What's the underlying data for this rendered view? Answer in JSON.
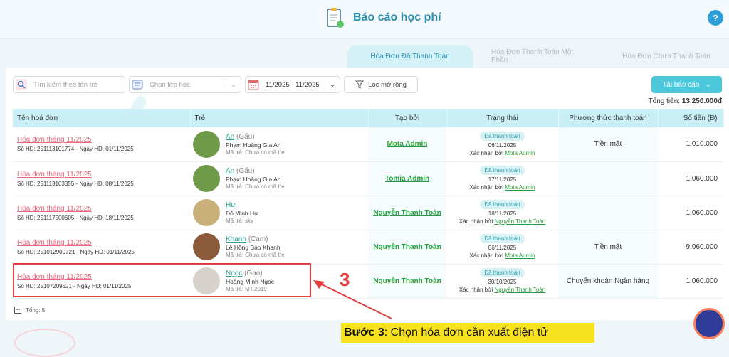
{
  "header": {
    "title": "Báo cáo học phí",
    "help_icon": "?"
  },
  "tabs": [
    {
      "label": "Hóa Đơn Đã Thanh Toán",
      "active": true
    },
    {
      "label": "Hóa Đơn Thanh Toán Một Phần",
      "active": false
    },
    {
      "label": "Hóa Đơn Chưa Thanh Toán",
      "active": false
    }
  ],
  "filters": {
    "search_placeholder": "Tìm kiếm theo tên trẻ",
    "class_placeholder": "Chọn lớp học",
    "date_range": "11/2025 - 11/2025",
    "more_label": "Lọc mở rộng"
  },
  "export_label": "Tải báo cáo",
  "total_label": "Tổng tiền:",
  "total_value": "13.250.000đ",
  "table": {
    "columns": [
      "Tên hoá đơn",
      "Trẻ",
      "Tạo bởi",
      "Trạng thái",
      "Phương thức thanh toán",
      "Số tiền (Đ)"
    ],
    "rows": [
      {
        "invoice": "Hóa đơn tháng 11/2025",
        "sub": "Số HD: 251113101774 - Ngày HD: 01/11/2025",
        "nick": "An",
        "alias": "(Gấu)",
        "full": "Phạm Hoàng Gia An",
        "code": "Mã trẻ: Chưa có mã trẻ",
        "by": "Mota Admin",
        "badge": "Đã thanh toán",
        "date": "06/11/2025",
        "confirm_prefix": "Xác nhận bởi",
        "confirm_by": "Mota Admin",
        "pay": "Tiền mặt",
        "amount": "1.010.000",
        "avatar_color": "#6e9a4a"
      },
      {
        "invoice": "Hóa đơn tháng 11/2025",
        "sub": "Số HD: 251113103355 - Ngày HD: 08/11/2025",
        "nick": "An",
        "alias": "(Gấu)",
        "full": "Phạm Hoàng Gia An",
        "code": "Mã trẻ: Chưa có mã trẻ",
        "by": "Tomia Admin",
        "badge": "Đã thanh toán",
        "date": "17/11/2025",
        "confirm_prefix": "Xác nhận bởi",
        "confirm_by": "Mota Admin",
        "pay": "",
        "amount": "1.060.000",
        "avatar_color": "#6e9a4a"
      },
      {
        "invoice": "Hóa đơn tháng 11/2025",
        "sub": "Số HD: 251117500605 - Ngày HD: 18/11/2025",
        "nick": "Hự",
        "alias": "",
        "full": "Đỗ Minh Hự",
        "code": "Mã trẻ: sky",
        "by": "Nguyễn Thanh Toàn",
        "badge": "Đã thanh toán",
        "date": "18/11/2025",
        "confirm_prefix": "Xác nhận bởi",
        "confirm_by": "Nguyễn Thanh Toàn",
        "pay": "",
        "amount": "1.060.000",
        "avatar_color": "#c9b07a"
      },
      {
        "invoice": "Hóa đơn tháng 11/2025",
        "sub": "Số HD: 251012900721 - Ngày HD: 01/11/2025",
        "nick": "Khanh",
        "alias": "(Cam)",
        "full": "Lê Hồng Bảo Khanh",
        "code": "Mã trẻ: Chưa có mã trẻ",
        "by": "Nguyễn Thanh Toàn",
        "badge": "Đã thanh toán",
        "date": "06/11/2025",
        "confirm_prefix": "Xác nhận bởi",
        "confirm_by": "Mota Admin",
        "pay": "Tiền mặt",
        "amount": "9.060.000",
        "avatar_color": "#8a5a3a"
      },
      {
        "invoice": "Hóa đơn tháng 11/2025",
        "sub": "Số HD: 25107209521 - Ngày HD: 01/11/2025",
        "nick": "Ngọc",
        "alias": "(Gạo)",
        "full": "Hoàng Minh Ngọc",
        "code": "Mã trẻ: MT.2019",
        "by": "Nguyễn Thanh Toàn",
        "badge": "Đã thanh toán",
        "date": "30/10/2025",
        "confirm_prefix": "Xác nhận bởi",
        "confirm_by": "Nguyễn Thanh Toàn",
        "pay": "Chuyển khoản Ngân hàng",
        "amount": "1.060.000",
        "avatar_color": "#d8d2cc"
      }
    ]
  },
  "footer": {
    "count_label": "Tổng: 5"
  },
  "annotation": {
    "number": "3",
    "step_prefix": "Bước 3",
    "step_text": ": Chọn hóa đơn cần xuất điện tử"
  },
  "colors": {
    "accent": "#4cc8dc",
    "header_row": "#c9eef6",
    "link_red": "#e8677c",
    "link_green": "#2a9c3e",
    "highlight": "#e33d3d",
    "step_bg": "#f8e21d"
  }
}
